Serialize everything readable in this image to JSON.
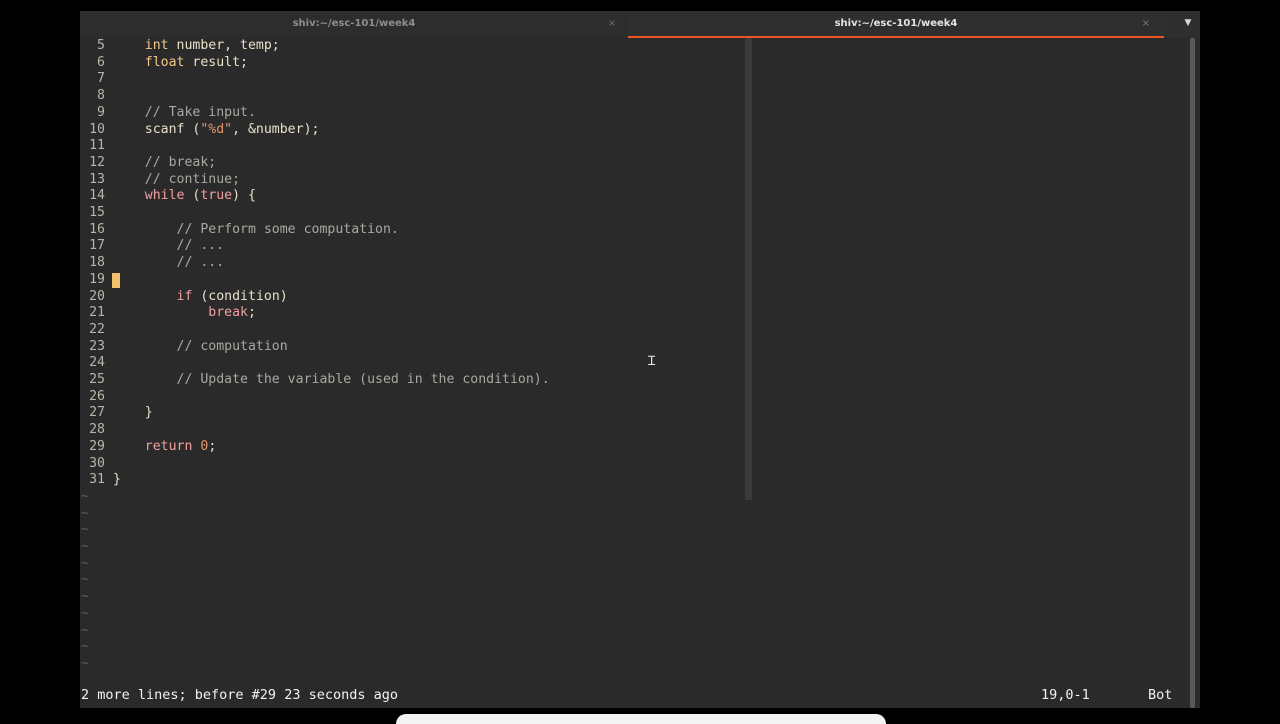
{
  "tabs": [
    {
      "title": "shiv:~/esc-101/week4",
      "active": false
    },
    {
      "title": "shiv:~/esc-101/week4",
      "active": true
    }
  ],
  "tab_close_glyph": "×",
  "menu_glyph": "▼",
  "editor": {
    "lines": [
      {
        "num": "5",
        "code": "    int number, temp;"
      },
      {
        "num": "6",
        "code": "    float result;"
      },
      {
        "num": "7",
        "code": ""
      },
      {
        "num": "8",
        "code": ""
      },
      {
        "num": "9",
        "code": "    // Take input."
      },
      {
        "num": "10",
        "code": "    scanf (\"%d\", &number);"
      },
      {
        "num": "11",
        "code": ""
      },
      {
        "num": "12",
        "code": "    // break;"
      },
      {
        "num": "13",
        "code": "    // continue;"
      },
      {
        "num": "14",
        "code": "    while (true) {"
      },
      {
        "num": "15",
        "code": ""
      },
      {
        "num": "16",
        "code": "        // Perform some computation."
      },
      {
        "num": "17",
        "code": "        // ..."
      },
      {
        "num": "18",
        "code": "        // ..."
      },
      {
        "num": "19",
        "code": ""
      },
      {
        "num": "20",
        "code": "        if (condition)"
      },
      {
        "num": "21",
        "code": "            break;"
      },
      {
        "num": "22",
        "code": ""
      },
      {
        "num": "23",
        "code": "        // computation"
      },
      {
        "num": "24",
        "code": ""
      },
      {
        "num": "25",
        "code": "        // Update the variable (used in the condition)."
      },
      {
        "num": "26",
        "code": ""
      },
      {
        "num": "27",
        "code": "    }"
      },
      {
        "num": "28",
        "code": ""
      },
      {
        "num": "29",
        "code": "    return 0;"
      },
      {
        "num": "30",
        "code": ""
      },
      {
        "num": "31",
        "code": "}"
      }
    ],
    "tildes": [
      "~",
      "~",
      "~",
      "~",
      "~",
      "~",
      "~",
      "~",
      "~",
      "~",
      "~"
    ],
    "cursor_line": "19"
  },
  "status": {
    "message": "2 more lines; before #29  23 seconds ago",
    "position": "19,0-1",
    "scroll": "Bot"
  },
  "colors": {
    "keyword": "#f0a0a0",
    "type": "#f2c98a",
    "comment": "#a8a8a0",
    "string": "#e3956c",
    "accent": "#e95420"
  },
  "icons": [
    "close-icon",
    "menu-arrow-icon",
    "text-cursor-icon"
  ]
}
